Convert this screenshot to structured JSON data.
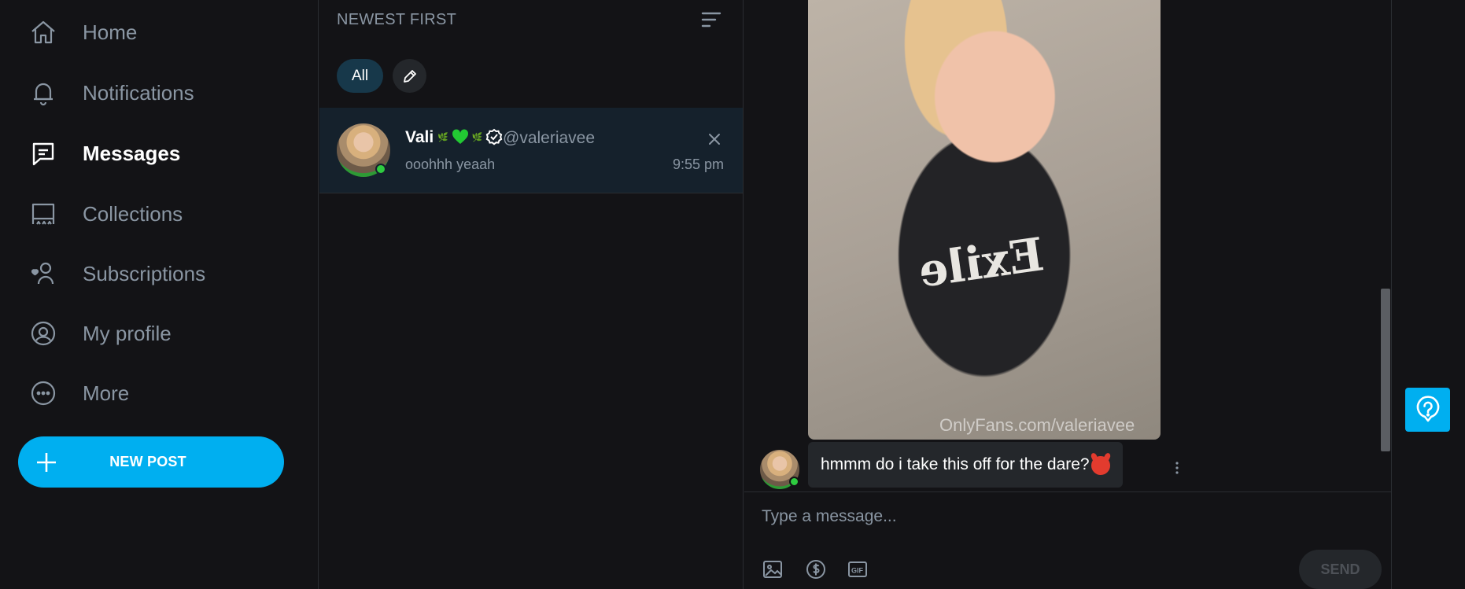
{
  "nav": {
    "items": [
      {
        "label": "Home",
        "icon": "home-icon",
        "active": false
      },
      {
        "label": "Notifications",
        "icon": "bell-icon",
        "active": false
      },
      {
        "label": "Messages",
        "icon": "message-icon",
        "active": true
      },
      {
        "label": "Collections",
        "icon": "bookmark-icon",
        "active": false
      },
      {
        "label": "Subscriptions",
        "icon": "subscriptions-icon",
        "active": false
      },
      {
        "label": "My profile",
        "icon": "profile-icon",
        "active": false
      },
      {
        "label": "More",
        "icon": "more-icon",
        "active": false
      }
    ],
    "new_post_label": "NEW POST"
  },
  "list": {
    "sort_label": "NEWEST FIRST",
    "filter_all": "All",
    "chats": [
      {
        "name": "Vali",
        "handle": "@valeriavee",
        "preview": "ooohhh yeaah",
        "time": "9:55 pm",
        "online": true
      }
    ]
  },
  "conversation": {
    "photo_watermark": "OnlyFans.com/valeriavee",
    "photo_shirt_text": "Exile",
    "message_text": "hmmm do i take this off for the dare?",
    "input_placeholder": "Type a message...",
    "send_label": "SEND",
    "tools": [
      "image-icon",
      "dollar-icon",
      "gif-icon"
    ]
  },
  "colors": {
    "background": "#131316",
    "accent": "#00aff0",
    "selected_row": "#15212c",
    "muted_text": "#8a96a3",
    "online": "#2ecc40"
  }
}
